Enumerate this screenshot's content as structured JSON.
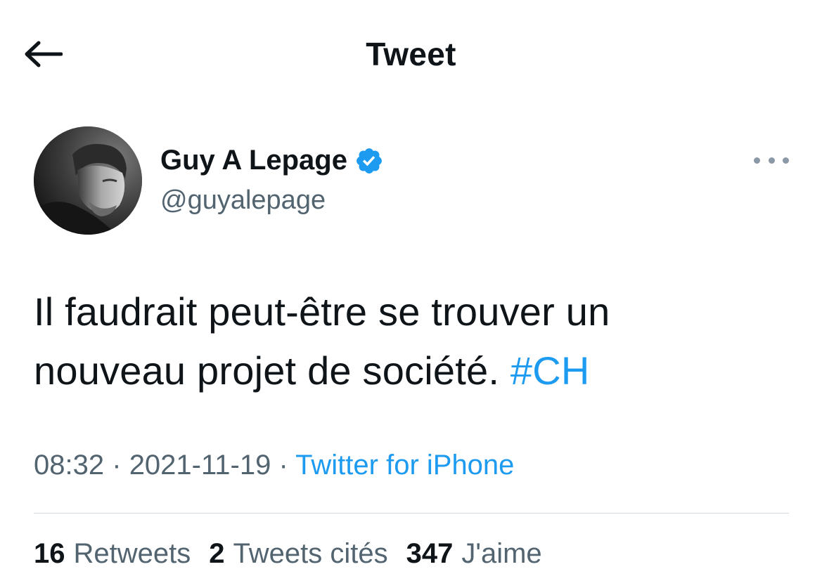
{
  "header": {
    "title": "Tweet",
    "back_icon": "arrow-left-icon"
  },
  "author": {
    "display_name": "Guy A Lepage",
    "handle": "@guyalepage",
    "verified_icon": "verified-badge-icon",
    "verified_color": "#1d9bf0",
    "more_icon": "more-horizontal-icon"
  },
  "tweet": {
    "text_line1": "Il faudrait peut-être se trouver un",
    "text_line2": "nouveau projet de société.",
    "hashtag": "#CH"
  },
  "meta": {
    "time": "08:32",
    "separator": "·",
    "date": "2021-11-19",
    "source": "Twitter for iPhone"
  },
  "stats": {
    "retweets_count": "16",
    "retweets_label": "Retweets",
    "quotes_count": "2",
    "quotes_label": "Tweets cités",
    "likes_count": "347",
    "likes_label": "J'aime"
  },
  "colors": {
    "accent": "#1d9bf0",
    "text_primary": "#0f1419",
    "text_secondary": "#536471",
    "divider": "#cfd9de"
  }
}
